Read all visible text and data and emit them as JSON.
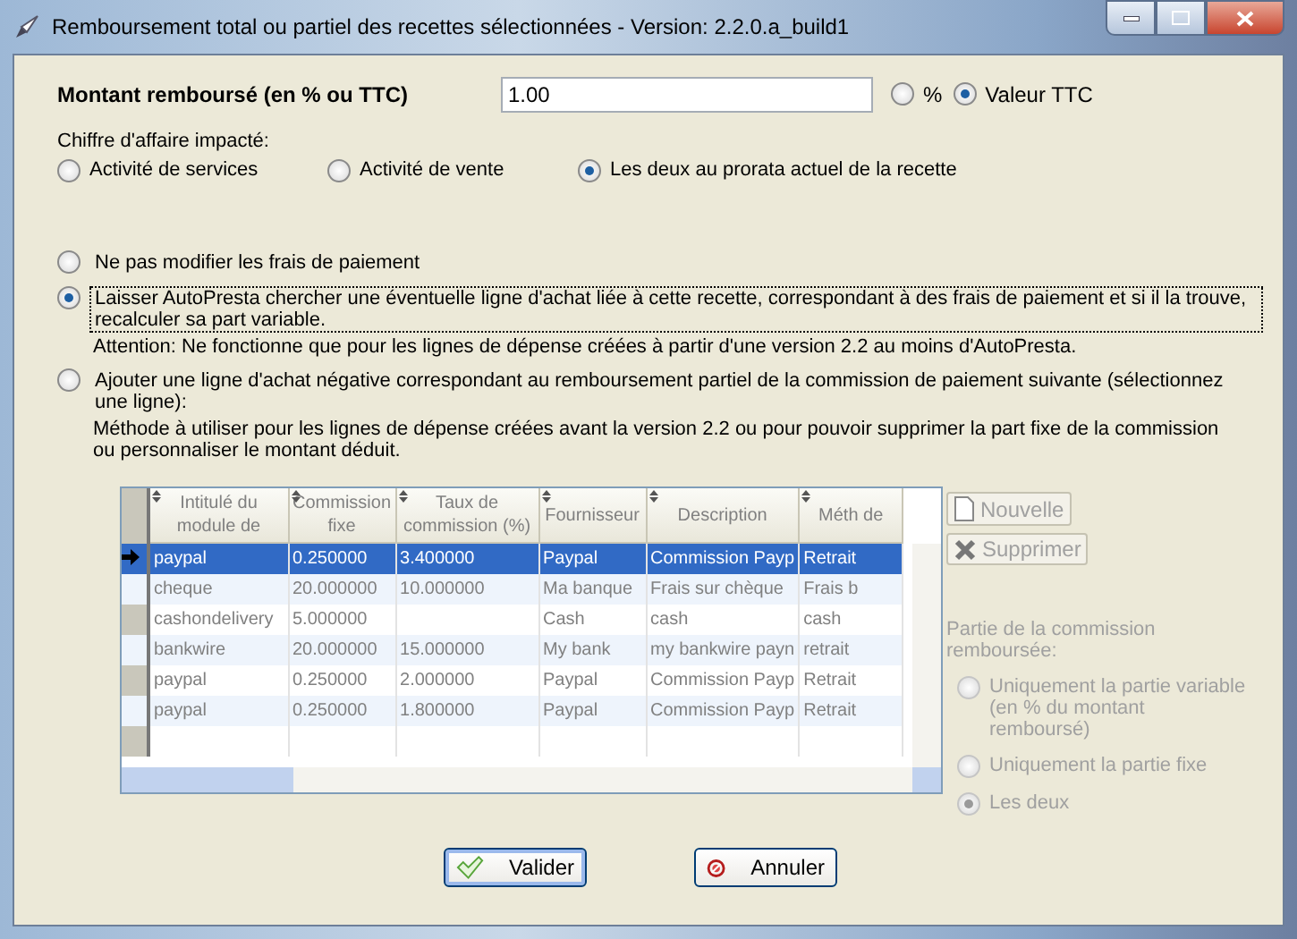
{
  "window": {
    "title": "Remboursement total ou partiel des recettes sélectionnées  -  Version:  2.2.0.a_build1"
  },
  "amount": {
    "label": "Montant remboursé (en % ou TTC)",
    "value": "1.00",
    "options": [
      {
        "label": "%",
        "selected": false
      },
      {
        "label": "Valeur TTC",
        "selected": true
      }
    ]
  },
  "revenue": {
    "label": "Chiffre d'affaire impacté:",
    "options": [
      {
        "label": "Activité de services",
        "selected": false
      },
      {
        "label": "Activité de vente",
        "selected": false
      },
      {
        "label": "Les deux au prorata actuel de la recette",
        "selected": true
      }
    ]
  },
  "payment_options": [
    {
      "label": "Ne pas modifier les frais de paiement",
      "selected": false,
      "focused": false
    },
    {
      "label": "Laisser AutoPresta chercher une éventuelle ligne d'achat liée à cette recette, correspondant à des frais de paiement et si il la trouve, recalculer sa part variable.",
      "note": "Attention: Ne fonctionne que pour les lignes de dépense créées à partir d'une version 2.2 au moins d'AutoPresta.",
      "selected": true,
      "focused": true
    },
    {
      "label": "Ajouter une ligne d'achat négative correspondant au remboursement partiel de la commission de paiement suivante (sélectionnez une ligne):",
      "note": "Méthode à utiliser pour les lignes de dépense créées avant la version 2.2 ou pour pouvoir supprimer la part fixe de la commission ou personnaliser le montant déduit.",
      "selected": false,
      "focused": false
    }
  ],
  "grid": {
    "disabled": true,
    "columns": [
      "Intitulé du module de",
      "Commission fixe",
      "Taux de commission (%)",
      "Fournisseur",
      "Description",
      "Méth de"
    ],
    "rows": [
      {
        "selected": true,
        "cells": [
          "paypal",
          "0.250000",
          "3.400000",
          "Paypal",
          "Commission Payp",
          "Retrait"
        ]
      },
      {
        "selected": false,
        "cells": [
          "cheque",
          "20.000000",
          "10.000000",
          "Ma banque",
          "Frais sur chèque",
          "Frais b"
        ]
      },
      {
        "selected": false,
        "cells": [
          "cashondelivery",
          "5.000000",
          "",
          "Cash",
          "cash",
          "cash"
        ]
      },
      {
        "selected": false,
        "cells": [
          "bankwire",
          "20.000000",
          "15.000000",
          "My bank",
          "my bankwire payn",
          "retrait"
        ]
      },
      {
        "selected": false,
        "cells": [
          "paypal",
          "0.250000",
          "2.000000",
          "Paypal",
          "Commission Payp",
          "Retrait"
        ]
      },
      {
        "selected": false,
        "cells": [
          "paypal",
          "0.250000",
          "1.800000",
          "Paypal",
          "Commission Payp",
          "Retrait"
        ]
      }
    ]
  },
  "grid_buttons": [
    {
      "kind": "new",
      "label": "Nouvelle",
      "disabled": true
    },
    {
      "kind": "delete",
      "label": "Supprimer",
      "disabled": true
    }
  ],
  "commission_part": {
    "label": "Partie de la commission remboursée:",
    "disabled": true,
    "options": [
      {
        "label": "Uniquement la partie variable (en % du montant remboursé)",
        "selected": false
      },
      {
        "label": "Uniquement la partie fixe",
        "selected": false
      },
      {
        "label": "Les deux",
        "selected": true
      }
    ]
  },
  "buttons": [
    {
      "kind": "ok",
      "label": "Valider",
      "focused": true
    },
    {
      "kind": "cancel",
      "label": "Annuler",
      "focused": false
    }
  ]
}
